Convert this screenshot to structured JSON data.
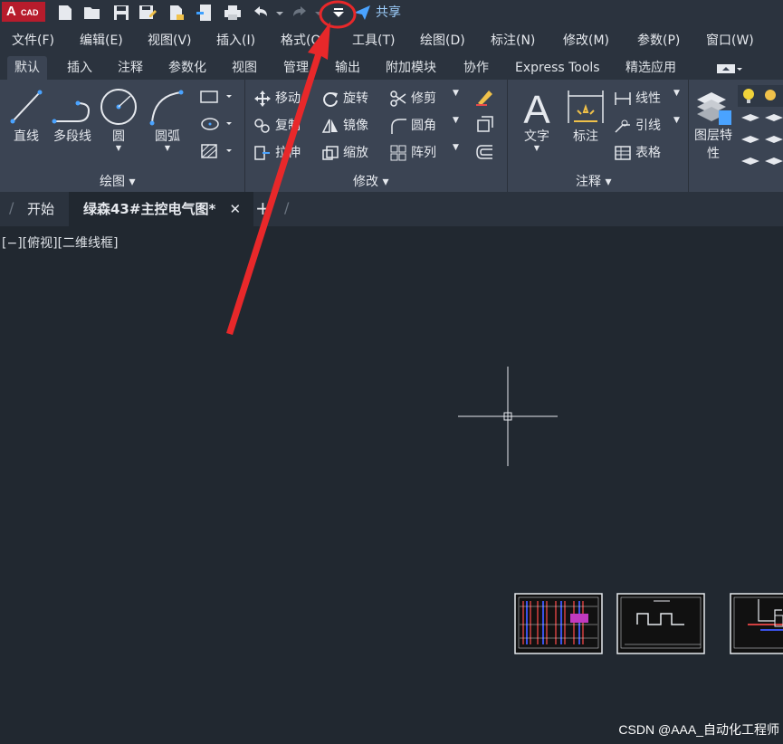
{
  "app": {
    "logo_letter": "A",
    "logo_text": "CAD"
  },
  "quick_access": {
    "icons": [
      "new-icon",
      "open-icon",
      "save-icon",
      "save-as-icon",
      "export-icon",
      "publish-icon",
      "print-icon",
      "undo-icon",
      "redo-icon",
      "dropdown-icon"
    ],
    "share_label": "共享"
  },
  "menu": {
    "items": [
      "文件(F)",
      "编辑(E)",
      "视图(V)",
      "插入(I)",
      "格式(O)",
      "工具(T)",
      "绘图(D)",
      "标注(N)",
      "修改(M)",
      "参数(P)",
      "窗口(W)"
    ]
  },
  "ribbon_tabs": {
    "items": [
      "默认",
      "插入",
      "注释",
      "参数化",
      "视图",
      "管理",
      "输出",
      "附加模块",
      "协作",
      "Express Tools",
      "精选应用"
    ],
    "active": 0
  },
  "panels": {
    "draw": {
      "title": "绘图",
      "line": "直线",
      "polyline": "多段线",
      "circle": "圆",
      "arc": "圆弧"
    },
    "modify": {
      "title": "修改",
      "move": "移动",
      "rotate": "旋转",
      "trim": "修剪",
      "copy": "复制",
      "mirror": "镜像",
      "fillet": "圆角",
      "stretch": "拉伸",
      "scale": "缩放",
      "array": "阵列"
    },
    "annotation": {
      "title": "注释",
      "text": "文字",
      "dimension": "标注",
      "linear": "线性",
      "leader": "引线",
      "table": "表格"
    },
    "layers": {
      "properties": "图层特性"
    }
  },
  "document_tabs": {
    "start": "开始",
    "active": "绿森43#主控电气图*",
    "close": "✕",
    "add": "+"
  },
  "viewport": {
    "label": "[−][俯视][二维线框]"
  },
  "watermark": "CSDN @AAA_自动化工程师",
  "colors": {
    "annotation_arrow": "#e8282a",
    "logo_red": "#b71c2c",
    "share_blue": "#4aa3ff"
  }
}
